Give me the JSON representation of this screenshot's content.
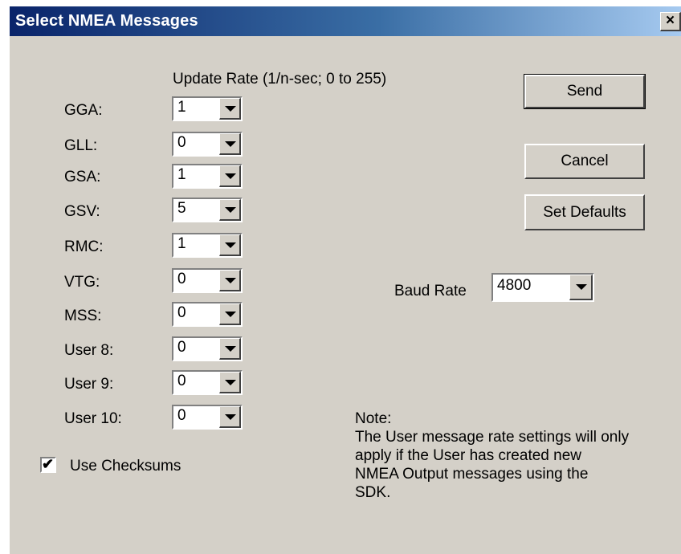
{
  "window": {
    "title": "Select NMEA Messages",
    "close_label": "×"
  },
  "update_rate_header": "Update Rate (1/n-sec; 0 to 255)",
  "messages": [
    {
      "label": "GGA:",
      "value": "1"
    },
    {
      "label": "GLL:",
      "value": "0"
    },
    {
      "label": "GSA:",
      "value": "1"
    },
    {
      "label": "GSV:",
      "value": "5"
    },
    {
      "label": "RMC:",
      "value": "1"
    },
    {
      "label": "VTG:",
      "value": "0"
    },
    {
      "label": "MSS:",
      "value": "0"
    },
    {
      "label": "User 8:",
      "value": "0"
    },
    {
      "label": "User 9:",
      "value": "0"
    },
    {
      "label": "User 10:",
      "value": "0"
    }
  ],
  "buttons": {
    "send": "Send",
    "cancel": "Cancel",
    "set_defaults": "Set Defaults"
  },
  "baud": {
    "label": "Baud Rate",
    "value": "4800"
  },
  "checksums": {
    "label": "Use Checksums",
    "checked": true,
    "check_glyph": "✔"
  },
  "note": {
    "title": "Note:",
    "lines": [
      "The User message rate settings will only",
      "apply if the User has created new",
      "NMEA Output messages using the",
      "SDK."
    ]
  },
  "icons": {
    "dropdown": "dropdown-arrow-icon",
    "checkmark": "checkmark-icon"
  }
}
